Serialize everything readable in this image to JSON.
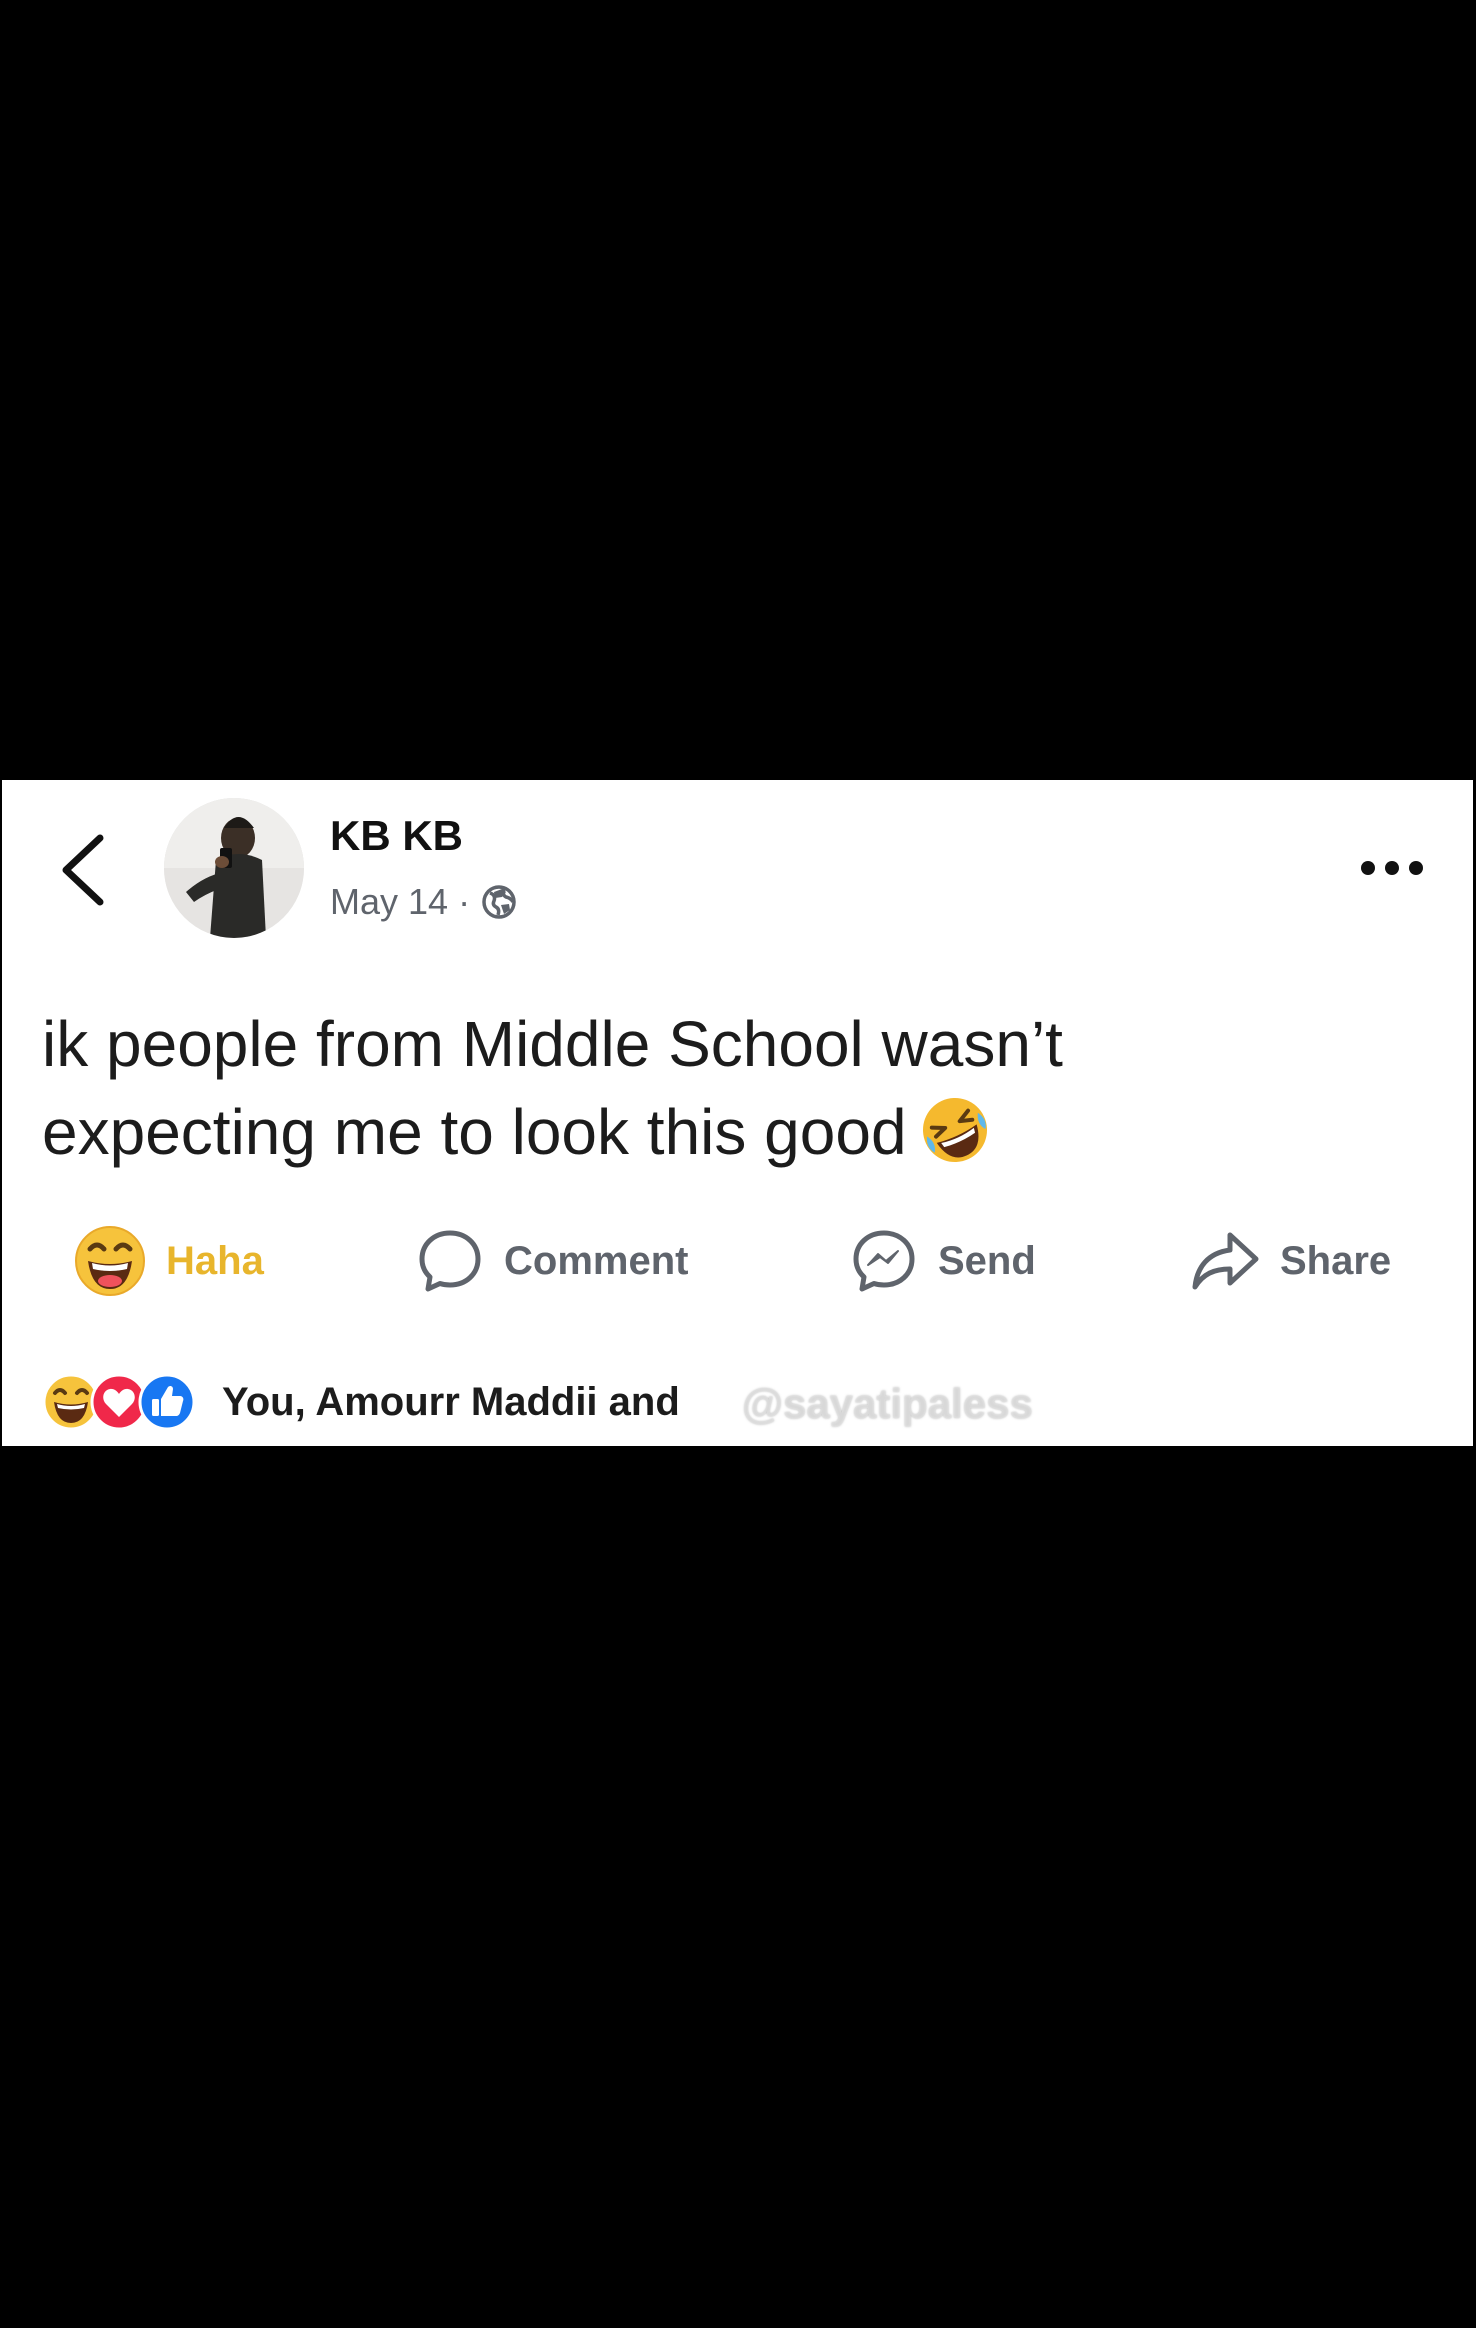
{
  "post": {
    "author_name": "KB KB",
    "date": "May 14",
    "separator": "·",
    "audience_icon": "globe-icon",
    "text_line_1": "ik people from Middle School wasn’t",
    "text_line_2": "expecting me to look this good",
    "text_emoji": "rolling-on-floor-laughing-icon"
  },
  "actions": {
    "haha_label": "Haha",
    "comment_label": "Comment",
    "send_label": "Send",
    "share_label": "Share"
  },
  "reactions": {
    "icons": [
      "haha-reaction-icon",
      "love-reaction-icon",
      "like-reaction-icon"
    ],
    "summary": "You, Amourr Maddii and"
  },
  "watermark": {
    "text": "@sayatipaless"
  },
  "colors": {
    "background": "#000000",
    "card": "#ffffff",
    "haha_label": "#e8b52c",
    "muted_text": "#5f646c",
    "like_blue": "#1877f2",
    "love_red": "#f0284a"
  }
}
